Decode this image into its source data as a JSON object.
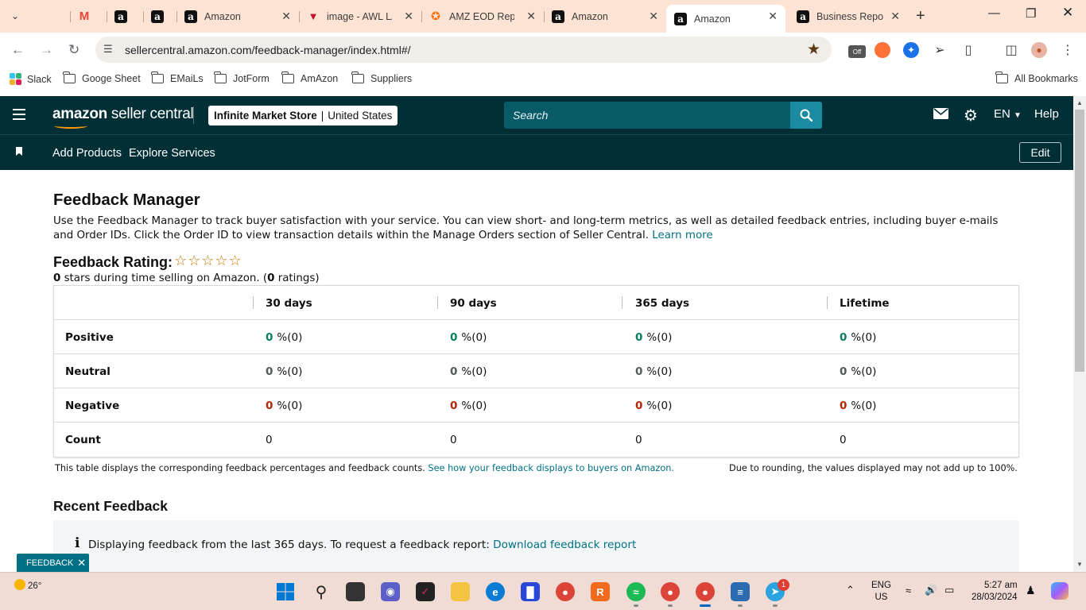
{
  "browser": {
    "tabs": [
      {
        "title": "",
        "icon": "slack-icon"
      },
      {
        "title": "",
        "icon": "gmail-icon"
      },
      {
        "title": "",
        "icon": "amazon-icon"
      },
      {
        "title": "",
        "icon": "amazon-icon"
      },
      {
        "title": "Amazon",
        "icon": "amazon-icon"
      },
      {
        "title": "image - AWL LA",
        "icon": "image-icon"
      },
      {
        "title": "AMZ EOD Repo",
        "icon": "zapier-icon"
      },
      {
        "title": "Amazon",
        "icon": "amazon-icon"
      },
      {
        "title": "Amazon",
        "icon": "amazon-icon",
        "active": true
      },
      {
        "title": "Business Report",
        "icon": "amazon-icon"
      }
    ],
    "url": "sellercentral.amazon.com/feedback-manager/index.html#/",
    "bookmarks": [
      {
        "label": "Slack",
        "type": "app"
      },
      {
        "label": "Googe Sheet",
        "type": "folder"
      },
      {
        "label": "EMaiLs",
        "type": "folder"
      },
      {
        "label": "JotForm",
        "type": "folder"
      },
      {
        "label": "AmAzon",
        "type": "folder"
      },
      {
        "label": "Suppliers",
        "type": "folder"
      }
    ],
    "all_bookmarks": "All Bookmarks"
  },
  "header": {
    "logo_amazon": "amazon",
    "logo_rest": " seller central",
    "store_name": "Infinite Market Store",
    "store_region": "United States",
    "search_placeholder": "Search",
    "language": "EN",
    "help": "Help"
  },
  "nav": {
    "add_products": "Add Products",
    "explore_services": "Explore Services",
    "edit": "Edit"
  },
  "page": {
    "title": "Feedback Manager",
    "intro": "Use the Feedback Manager to track buyer satisfaction with your service. You can view short- and long-term metrics, as well as detailed feedback entries, including buyer e-mails and Order IDs. Click the Order ID to view transaction details within the Manage Orders section of Seller Central.",
    "learn_more": "Learn more",
    "rating_title": "Feedback Rating:",
    "stars_display": "☆☆☆☆☆",
    "rating_stars_value": "0",
    "rating_mid": " stars during time selling on Amazon. (",
    "rating_count": "0",
    "rating_end": " ratings)"
  },
  "feedback_table": {
    "columns": [
      "30 days",
      "90 days",
      "365 days",
      "Lifetime"
    ],
    "rows": [
      {
        "label": "Positive",
        "values": [
          "0",
          "0",
          "0",
          "0"
        ],
        "suffix": "%(0)"
      },
      {
        "label": "Neutral",
        "values": [
          "0",
          "0",
          "0",
          "0"
        ],
        "suffix": "%(0)"
      },
      {
        "label": "Negative",
        "values": [
          "0",
          "0",
          "0",
          "0"
        ],
        "suffix": "%(0)"
      },
      {
        "label": "Count",
        "values": [
          "0",
          "0",
          "0",
          "0"
        ]
      }
    ],
    "note_left": "This table displays the corresponding feedback percentages and feedback counts.",
    "note_link": "See how your feedback displays to buyers on Amazon.",
    "note_right": "Due to rounding, the values displayed may not add up to 100%."
  },
  "recent": {
    "title": "Recent Feedback",
    "info_text": "Displaying feedback from the last 365 days. To request a feedback report:",
    "info_link": "Download feedback report"
  },
  "feedback_tag": "FEEDBACK",
  "taskbar": {
    "temperature": "26°",
    "lang_top": "ENG",
    "lang_bottom": "US",
    "time": "5:27 am",
    "date": "28/03/2024",
    "telegram_badge": "1"
  }
}
